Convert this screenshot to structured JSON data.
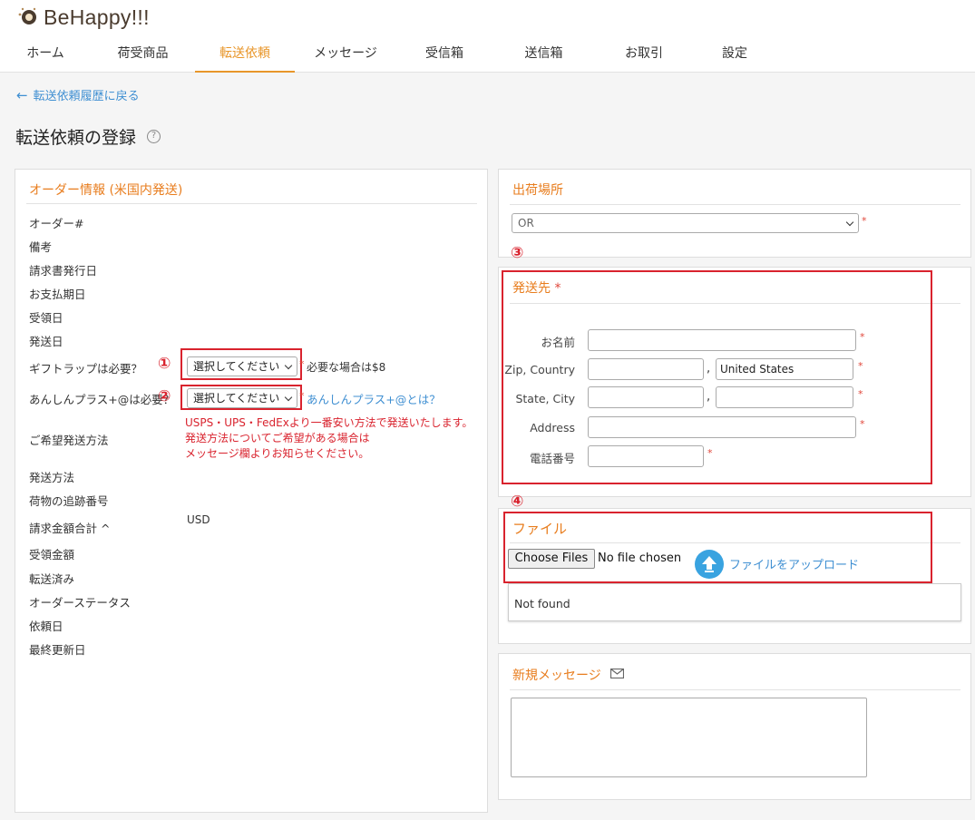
{
  "brand": {
    "name": "BeHappy!!!"
  },
  "nav": [
    {
      "label": "ホーム",
      "width": 100,
      "active": false
    },
    {
      "label": "荷受商品",
      "width": 115,
      "active": false
    },
    {
      "label": "転送依頼",
      "width": 110,
      "active": true
    },
    {
      "label": "メッセージ",
      "width": 112,
      "active": false
    },
    {
      "label": "受信箱",
      "width": 106,
      "active": false
    },
    {
      "label": "送信箱",
      "width": 113,
      "active": false
    },
    {
      "label": "お取引",
      "width": 108,
      "active": false
    },
    {
      "label": "設定",
      "width": 92,
      "active": false
    }
  ],
  "back_link": "転送依頼履歴に戻る",
  "page_title": "転送依頼の登録",
  "help_icon": "?",
  "order_panel": {
    "title": "オーダー情報 (米国内発送)",
    "labels": {
      "order_no": "オーダー#",
      "remarks": "備考",
      "invoice_date": "請求書発行日",
      "due_date": "お支払期日",
      "received_date": "受領日",
      "ship_date": "発送日",
      "gift_wrap": "ギフトラップは必要？",
      "anshin": "あんしんプラス+@は必要？",
      "preferred_method": "ご希望発送方法",
      "ship_method": "発送方法",
      "tracking": "荷物の追跡番号",
      "invoice_total": "請求金額合計 ^",
      "received_amount": "受領金額",
      "forwarded": "転送済み",
      "order_status": "オーダーステータス",
      "request_date": "依頼日",
      "updated_date": "最終更新日"
    },
    "gift_select": "選択してください",
    "gift_note": "必要な場合は$8",
    "anshin_select": "選択してください",
    "anshin_link": "あんしんプラス+@とは？",
    "marker1": "①",
    "marker2": "②",
    "shipping_note_1": "USPS・UPS・FedExより一番安い方法で発送いたします。",
    "shipping_note_2": "発送方法についてご希望がある場合は",
    "shipping_note_3": "メッセージ欄よりお知らせください。",
    "currency": "USD"
  },
  "ship_from_panel": {
    "title": "出荷場所",
    "select": "OR"
  },
  "ship_to_panel": {
    "marker": "③",
    "title": "発送先",
    "name_label": "お名前",
    "zip_country_label": "Zip, Country",
    "country_value": "United States",
    "state_city_label": "State, City",
    "address_label": "Address",
    "phone_label": "電話番号"
  },
  "file_panel": {
    "marker": "④",
    "title": "ファイル",
    "choose_button": "Choose Files",
    "no_file": "No file chosen",
    "upload_label": "ファイルをアップロード",
    "not_found": "Not found"
  },
  "message_panel": {
    "title": "新規メッセージ"
  },
  "colors": {
    "accent": "#e8962a",
    "title_orange": "#e87d1e",
    "link_blue": "#3f8fd2",
    "annotation_red": "#d9232e"
  }
}
